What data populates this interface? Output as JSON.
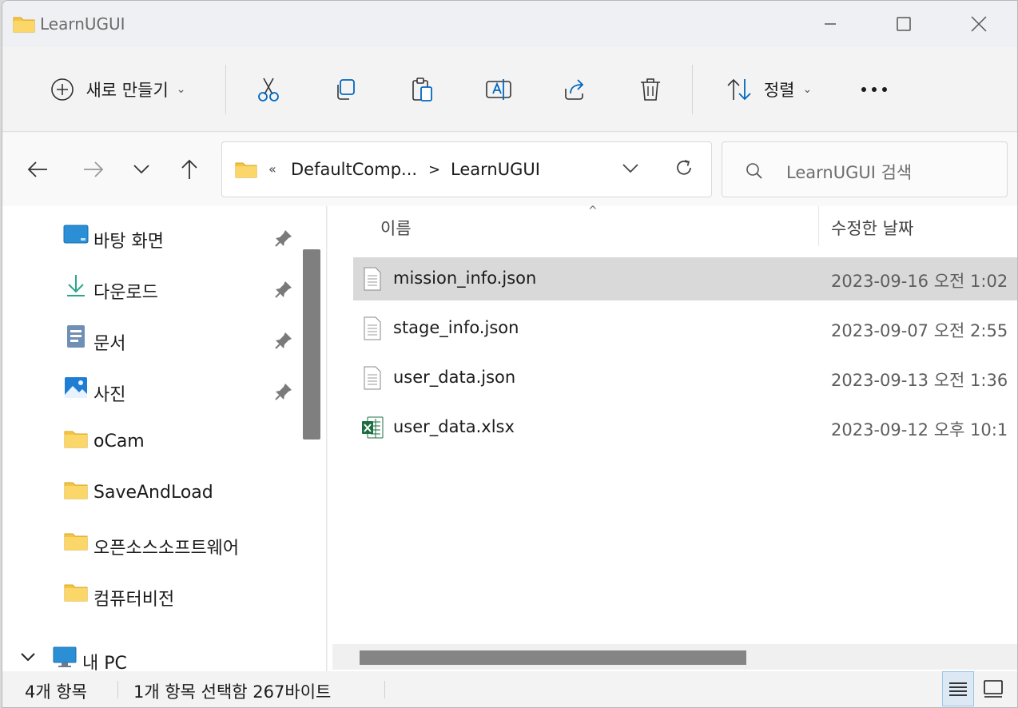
{
  "window": {
    "title": "LearnUGUI"
  },
  "toolbar": {
    "new_label": "새로 만들기",
    "sort_label": "정렬"
  },
  "address": {
    "overflow": "«",
    "crumbs": [
      "DefaultComp...",
      "LearnUGUI"
    ],
    "separator": ">"
  },
  "search": {
    "placeholder": "LearnUGUI 검색"
  },
  "sidebar": {
    "items": [
      {
        "label": "바탕 화면",
        "icon": "desktop-icon",
        "pinned": true
      },
      {
        "label": "다운로드",
        "icon": "download-icon",
        "pinned": true
      },
      {
        "label": "문서",
        "icon": "documents-icon",
        "pinned": true
      },
      {
        "label": "사진",
        "icon": "pictures-icon",
        "pinned": true
      },
      {
        "label": "oCam",
        "icon": "folder-icon",
        "pinned": false
      },
      {
        "label": "SaveAndLoad",
        "icon": "folder-icon",
        "pinned": false
      },
      {
        "label": "오픈소스소프트웨어",
        "icon": "folder-icon",
        "pinned": false
      },
      {
        "label": "컴퓨터비전",
        "icon": "folder-icon",
        "pinned": false
      }
    ],
    "this_pc": "내 PC"
  },
  "content": {
    "columns": {
      "name": "이름",
      "modified": "수정한 날짜"
    },
    "files": [
      {
        "name": "mission_info.json",
        "date": "2023-09-16 오전 1:02",
        "type": "json",
        "selected": true
      },
      {
        "name": "stage_info.json",
        "date": "2023-09-07 오전 2:55",
        "type": "json",
        "selected": false
      },
      {
        "name": "user_data.json",
        "date": "2023-09-13 오전 1:36",
        "type": "json",
        "selected": false
      },
      {
        "name": "user_data.xlsx",
        "date": "2023-09-12 오후 10:1",
        "type": "xlsx",
        "selected": false
      }
    ]
  },
  "status": {
    "count": "4개 항목",
    "selection": "1개 항목 선택함 267바이트"
  },
  "colors": {
    "accent": "#0067c0",
    "selected_row": "#d9d9d9",
    "folder": "#f4c542",
    "excel": "#1d6f42"
  }
}
